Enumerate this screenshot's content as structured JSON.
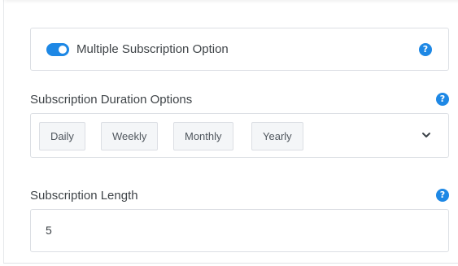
{
  "multiple_option": {
    "label": "Multiple Subscription Option",
    "enabled": true,
    "help": "?"
  },
  "duration": {
    "label": "Subscription Duration Options",
    "help": "?",
    "options": [
      "Daily",
      "Weekly",
      "Monthly",
      "Yearly"
    ],
    "dropdown_icon": "chevron-down-icon"
  },
  "length": {
    "label": "Subscription Length",
    "help": "?",
    "value": "5"
  },
  "colors": {
    "accent": "#1e88e5",
    "border": "#dcdfe4",
    "chip_bg": "#f4f6f8",
    "text": "#3f4448"
  }
}
